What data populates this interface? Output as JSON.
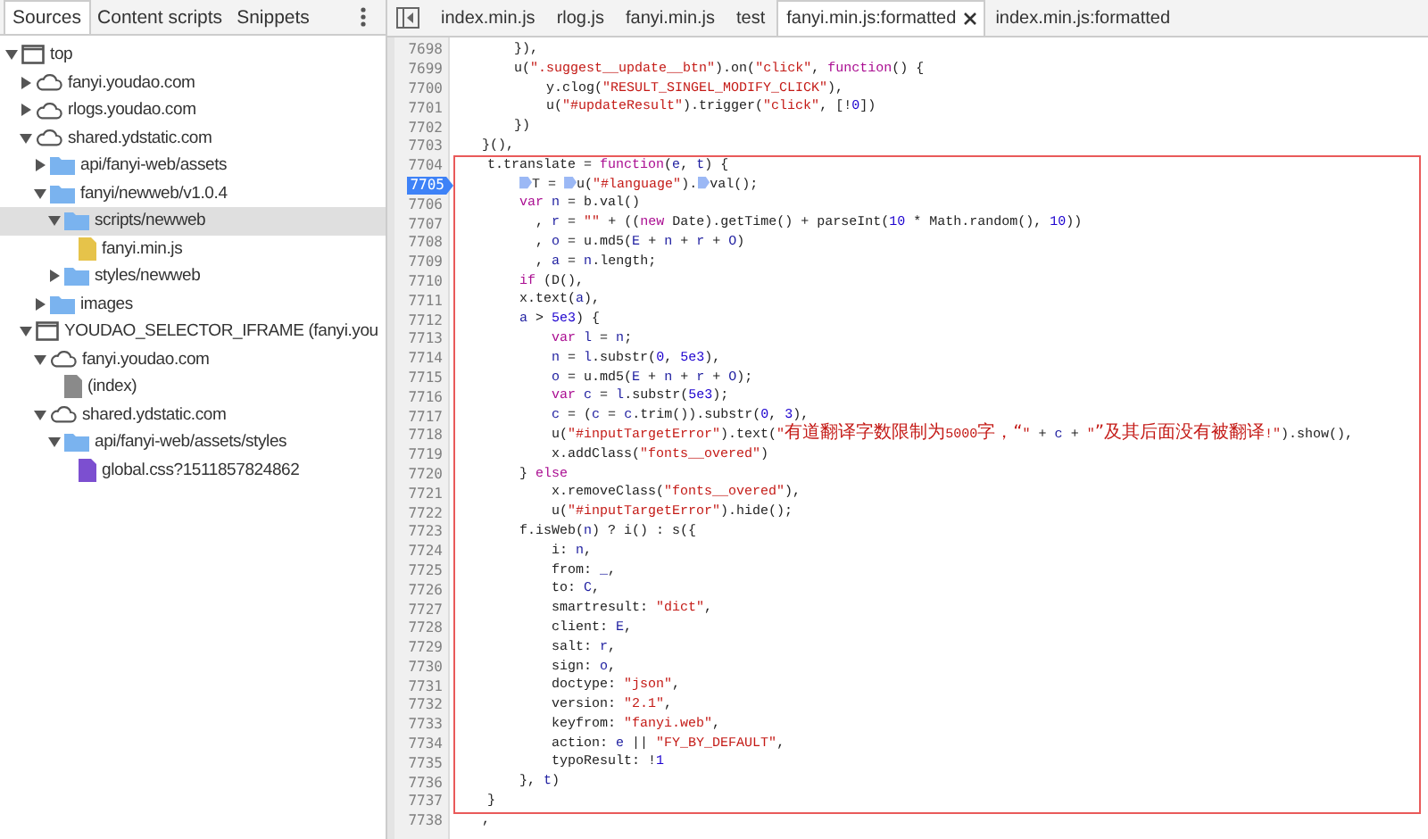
{
  "navigator": {
    "tabs": [
      {
        "label": "Sources",
        "selected": true
      },
      {
        "label": "Content scripts",
        "selected": false
      },
      {
        "label": "Snippets",
        "selected": false
      }
    ],
    "tree": [
      {
        "label": "top",
        "kind": "frame",
        "expanded": true,
        "selected": false,
        "children": [
          {
            "label": "fanyi.youdao.com",
            "kind": "domain",
            "expanded": false,
            "selected": false
          },
          {
            "label": "rlogs.youdao.com",
            "kind": "domain",
            "expanded": false,
            "selected": false
          },
          {
            "label": "shared.ydstatic.com",
            "kind": "domain",
            "expanded": true,
            "selected": false,
            "children": [
              {
                "label": "api/fanyi-web/assets",
                "kind": "folder",
                "expanded": false,
                "selected": false
              },
              {
                "label": "fanyi/newweb/v1.0.4",
                "kind": "folder",
                "expanded": true,
                "selected": false,
                "children": [
                  {
                    "label": "scripts/newweb",
                    "kind": "folder",
                    "expanded": true,
                    "selected": true,
                    "children": [
                      {
                        "label": "fanyi.min.js",
                        "kind": "script",
                        "selected": false
                      }
                    ]
                  },
                  {
                    "label": "styles/newweb",
                    "kind": "folder",
                    "expanded": false,
                    "selected": false
                  }
                ]
              },
              {
                "label": "images",
                "kind": "folder",
                "expanded": false,
                "selected": false
              }
            ]
          },
          {
            "label": "YOUDAO_SELECTOR_IFRAME (fanyi.you",
            "kind": "frame",
            "expanded": true,
            "selected": false,
            "children": [
              {
                "label": "fanyi.youdao.com",
                "kind": "domain",
                "expanded": true,
                "selected": false,
                "children": [
                  {
                    "label": "(index)",
                    "kind": "document",
                    "selected": false
                  }
                ]
              },
              {
                "label": "shared.ydstatic.com",
                "kind": "domain",
                "expanded": true,
                "selected": false,
                "children": [
                  {
                    "label": "api/fanyi-web/assets/styles",
                    "kind": "folder",
                    "expanded": true,
                    "selected": false,
                    "children": [
                      {
                        "label": "global.css?1511857824862",
                        "kind": "stylesheet",
                        "selected": false
                      }
                    ]
                  }
                ]
              }
            ]
          }
        ]
      }
    ]
  },
  "editor": {
    "tabs": [
      {
        "label": "index.min.js",
        "selected": false,
        "closable": false
      },
      {
        "label": "rlog.js",
        "selected": false,
        "closable": false
      },
      {
        "label": "fanyi.min.js",
        "selected": false,
        "closable": false
      },
      {
        "label": "test",
        "selected": false,
        "closable": false
      },
      {
        "label": "fanyi.min.js:formatted",
        "selected": true,
        "closable": true
      },
      {
        "label": "index.min.js:formatted",
        "selected": false,
        "closable": false
      }
    ],
    "blocks": [
      {
        "boxed": false,
        "lines": [
          {
            "number": "7698",
            "breakpoint": false,
            "segs": [
              {
                "kind": "plain",
                "text": "        }),"
              }
            ]
          },
          {
            "number": "7699",
            "breakpoint": false,
            "segs": [
              {
                "kind": "plain",
                "text": "        u("
              },
              {
                "kind": "string",
                "text": "\".suggest__update__btn\""
              },
              {
                "kind": "plain",
                "text": ").on("
              },
              {
                "kind": "string",
                "text": "\"click\""
              },
              {
                "kind": "plain",
                "text": ", "
              },
              {
                "kind": "keyword",
                "text": "function"
              },
              {
                "kind": "plain",
                "text": "() {"
              }
            ]
          },
          {
            "number": "7700",
            "breakpoint": false,
            "segs": [
              {
                "kind": "plain",
                "text": "            y.clog("
              },
              {
                "kind": "string",
                "text": "\"RESULT_SINGEL_MODIFY_CLICK\""
              },
              {
                "kind": "plain",
                "text": "),"
              }
            ]
          },
          {
            "number": "7701",
            "breakpoint": false,
            "segs": [
              {
                "kind": "plain",
                "text": "            u("
              },
              {
                "kind": "string",
                "text": "\"#updateResult\""
              },
              {
                "kind": "plain",
                "text": ").trigger("
              },
              {
                "kind": "string",
                "text": "\"click\""
              },
              {
                "kind": "plain",
                "text": ", [!"
              },
              {
                "kind": "number",
                "text": "0"
              },
              {
                "kind": "plain",
                "text": "])"
              }
            ]
          },
          {
            "number": "7702",
            "breakpoint": false,
            "segs": [
              {
                "kind": "plain",
                "text": "        })"
              }
            ]
          },
          {
            "number": "7703",
            "breakpoint": false,
            "segs": [
              {
                "kind": "plain",
                "text": "    }(),"
              }
            ]
          }
        ]
      },
      {
        "boxed": true,
        "lines": [
          {
            "number": "7704",
            "breakpoint": false,
            "segs": [
              {
                "kind": "plain",
                "text": "    t.translate = "
              },
              {
                "kind": "keyword",
                "text": "function"
              },
              {
                "kind": "plain",
                "text": "("
              },
              {
                "kind": "variable",
                "text": "e"
              },
              {
                "kind": "plain",
                "text": ", "
              },
              {
                "kind": "variable",
                "text": "t"
              },
              {
                "kind": "plain",
                "text": ") {"
              }
            ]
          },
          {
            "number": "7705",
            "breakpoint": true,
            "segs": [
              {
                "kind": "plain",
                "text": "        T = ",
                "marker": true
              },
              {
                "kind": "plain",
                "text": "u(",
                "marker": true
              },
              {
                "kind": "string",
                "text": "\"#language\""
              },
              {
                "kind": "plain",
                "text": ")."
              },
              {
                "kind": "plain",
                "text": "val();",
                "marker": true
              }
            ]
          },
          {
            "number": "7706",
            "breakpoint": false,
            "segs": [
              {
                "kind": "keyword",
                "text": "        var "
              },
              {
                "kind": "variable",
                "text": "n"
              },
              {
                "kind": "plain",
                "text": " = b.val()"
              }
            ]
          },
          {
            "number": "7707",
            "breakpoint": false,
            "segs": [
              {
                "kind": "plain",
                "text": "          , "
              },
              {
                "kind": "variable",
                "text": "r"
              },
              {
                "kind": "plain",
                "text": " = "
              },
              {
                "kind": "string",
                "text": "\"\""
              },
              {
                "kind": "plain",
                "text": " + (("
              },
              {
                "kind": "keyword",
                "text": "new"
              },
              {
                "kind": "plain",
                "text": " Date).getTime() + parseInt("
              },
              {
                "kind": "number",
                "text": "10"
              },
              {
                "kind": "plain",
                "text": " * Math.random(), "
              },
              {
                "kind": "number",
                "text": "10"
              },
              {
                "kind": "plain",
                "text": "))"
              }
            ]
          },
          {
            "number": "7708",
            "breakpoint": false,
            "segs": [
              {
                "kind": "plain",
                "text": "          , "
              },
              {
                "kind": "variable",
                "text": "o"
              },
              {
                "kind": "plain",
                "text": " = u.md5("
              },
              {
                "kind": "variable",
                "text": "E"
              },
              {
                "kind": "plain",
                "text": " + "
              },
              {
                "kind": "variable",
                "text": "n"
              },
              {
                "kind": "plain",
                "text": " + "
              },
              {
                "kind": "variable",
                "text": "r"
              },
              {
                "kind": "plain",
                "text": " + "
              },
              {
                "kind": "variable",
                "text": "O"
              },
              {
                "kind": "plain",
                "text": ")"
              }
            ]
          },
          {
            "number": "7709",
            "breakpoint": false,
            "segs": [
              {
                "kind": "plain",
                "text": "          , "
              },
              {
                "kind": "variable",
                "text": "a"
              },
              {
                "kind": "plain",
                "text": " = "
              },
              {
                "kind": "variable",
                "text": "n"
              },
              {
                "kind": "plain",
                "text": ".length;"
              }
            ]
          },
          {
            "number": "7710",
            "breakpoint": false,
            "segs": [
              {
                "kind": "keyword",
                "text": "        if"
              },
              {
                "kind": "plain",
                "text": " (D(),"
              }
            ]
          },
          {
            "number": "7711",
            "breakpoint": false,
            "segs": [
              {
                "kind": "plain",
                "text": "        x.text("
              },
              {
                "kind": "variable",
                "text": "a"
              },
              {
                "kind": "plain",
                "text": "),"
              }
            ]
          },
          {
            "number": "7712",
            "breakpoint": false,
            "segs": [
              {
                "kind": "variable",
                "text": "        a"
              },
              {
                "kind": "plain",
                "text": " > "
              },
              {
                "kind": "number",
                "text": "5e3"
              },
              {
                "kind": "plain",
                "text": ") {"
              }
            ]
          },
          {
            "number": "7713",
            "breakpoint": false,
            "segs": [
              {
                "kind": "keyword",
                "text": "            var "
              },
              {
                "kind": "variable",
                "text": "l"
              },
              {
                "kind": "plain",
                "text": " = "
              },
              {
                "kind": "variable",
                "text": "n"
              },
              {
                "kind": "plain",
                "text": ";"
              }
            ]
          },
          {
            "number": "7714",
            "breakpoint": false,
            "segs": [
              {
                "kind": "variable",
                "text": "            n"
              },
              {
                "kind": "plain",
                "text": " = "
              },
              {
                "kind": "variable",
                "text": "l"
              },
              {
                "kind": "plain",
                "text": ".substr("
              },
              {
                "kind": "number",
                "text": "0"
              },
              {
                "kind": "plain",
                "text": ", "
              },
              {
                "kind": "number",
                "text": "5e3"
              },
              {
                "kind": "plain",
                "text": "),"
              }
            ]
          },
          {
            "number": "7715",
            "breakpoint": false,
            "segs": [
              {
                "kind": "variable",
                "text": "            o"
              },
              {
                "kind": "plain",
                "text": " = u.md5("
              },
              {
                "kind": "variable",
                "text": "E"
              },
              {
                "kind": "plain",
                "text": " + "
              },
              {
                "kind": "variable",
                "text": "n"
              },
              {
                "kind": "plain",
                "text": " + "
              },
              {
                "kind": "variable",
                "text": "r"
              },
              {
                "kind": "plain",
                "text": " + "
              },
              {
                "kind": "variable",
                "text": "O"
              },
              {
                "kind": "plain",
                "text": ");"
              }
            ]
          },
          {
            "number": "7716",
            "breakpoint": false,
            "segs": [
              {
                "kind": "keyword",
                "text": "            var "
              },
              {
                "kind": "variable",
                "text": "c"
              },
              {
                "kind": "plain",
                "text": " = "
              },
              {
                "kind": "variable",
                "text": "l"
              },
              {
                "kind": "plain",
                "text": ".substr("
              },
              {
                "kind": "number",
                "text": "5e3"
              },
              {
                "kind": "plain",
                "text": ");"
              }
            ]
          },
          {
            "number": "7717",
            "breakpoint": false,
            "segs": [
              {
                "kind": "variable",
                "text": "            c"
              },
              {
                "kind": "plain",
                "text": " = ("
              },
              {
                "kind": "variable",
                "text": "c"
              },
              {
                "kind": "plain",
                "text": " = "
              },
              {
                "kind": "variable",
                "text": "c"
              },
              {
                "kind": "plain",
                "text": ".trim()).substr("
              },
              {
                "kind": "number",
                "text": "0"
              },
              {
                "kind": "plain",
                "text": ", "
              },
              {
                "kind": "number",
                "text": "3"
              },
              {
                "kind": "plain",
                "text": "),"
              }
            ]
          },
          {
            "number": "7718",
            "breakpoint": false,
            "segs": [
              {
                "kind": "plain",
                "text": "            u("
              },
              {
                "kind": "string",
                "text": "\"#inputTargetError\""
              },
              {
                "kind": "plain",
                "text": ").text("
              },
              {
                "kind": "string",
                "text": "\"有道翻译字数限制为5000字，“\""
              },
              {
                "kind": "plain",
                "text": " + "
              },
              {
                "kind": "variable",
                "text": "c"
              },
              {
                "kind": "plain",
                "text": " + "
              },
              {
                "kind": "string",
                "text": "\"”及其后面没有被翻译!\""
              },
              {
                "kind": "plain",
                "text": ").show(),"
              }
            ]
          },
          {
            "number": "7719",
            "breakpoint": false,
            "segs": [
              {
                "kind": "plain",
                "text": "            x.addClass("
              },
              {
                "kind": "string",
                "text": "\"fonts__overed\""
              },
              {
                "kind": "plain",
                "text": ")"
              }
            ]
          },
          {
            "number": "7720",
            "breakpoint": false,
            "segs": [
              {
                "kind": "plain",
                "text": "        } "
              },
              {
                "kind": "keyword",
                "text": "else"
              }
            ]
          },
          {
            "number": "7721",
            "breakpoint": false,
            "segs": [
              {
                "kind": "plain",
                "text": "            x.removeClass("
              },
              {
                "kind": "string",
                "text": "\"fonts__overed\""
              },
              {
                "kind": "plain",
                "text": "),"
              }
            ]
          },
          {
            "number": "7722",
            "breakpoint": false,
            "segs": [
              {
                "kind": "plain",
                "text": "            u("
              },
              {
                "kind": "string",
                "text": "\"#inputTargetError\""
              },
              {
                "kind": "plain",
                "text": ").hide();"
              }
            ]
          },
          {
            "number": "7723",
            "breakpoint": false,
            "segs": [
              {
                "kind": "plain",
                "text": "        f.isWeb("
              },
              {
                "kind": "variable",
                "text": "n"
              },
              {
                "kind": "plain",
                "text": ") ? i() : s({"
              }
            ]
          },
          {
            "number": "7724",
            "breakpoint": false,
            "segs": [
              {
                "kind": "plain",
                "text": "            i: "
              },
              {
                "kind": "variable",
                "text": "n"
              },
              {
                "kind": "plain",
                "text": ","
              }
            ]
          },
          {
            "number": "7725",
            "breakpoint": false,
            "segs": [
              {
                "kind": "plain",
                "text": "            from: "
              },
              {
                "kind": "variable",
                "text": "_"
              },
              {
                "kind": "plain",
                "text": ","
              }
            ]
          },
          {
            "number": "7726",
            "breakpoint": false,
            "segs": [
              {
                "kind": "plain",
                "text": "            to: "
              },
              {
                "kind": "variable",
                "text": "C"
              },
              {
                "kind": "plain",
                "text": ","
              }
            ]
          },
          {
            "number": "7727",
            "breakpoint": false,
            "segs": [
              {
                "kind": "plain",
                "text": "            smartresult: "
              },
              {
                "kind": "string",
                "text": "\"dict\""
              },
              {
                "kind": "plain",
                "text": ","
              }
            ]
          },
          {
            "number": "7728",
            "breakpoint": false,
            "segs": [
              {
                "kind": "plain",
                "text": "            client: "
              },
              {
                "kind": "variable",
                "text": "E"
              },
              {
                "kind": "plain",
                "text": ","
              }
            ]
          },
          {
            "number": "7729",
            "breakpoint": false,
            "segs": [
              {
                "kind": "plain",
                "text": "            salt: "
              },
              {
                "kind": "variable",
                "text": "r"
              },
              {
                "kind": "plain",
                "text": ","
              }
            ]
          },
          {
            "number": "7730",
            "breakpoint": false,
            "segs": [
              {
                "kind": "plain",
                "text": "            sign: "
              },
              {
                "kind": "variable",
                "text": "o"
              },
              {
                "kind": "plain",
                "text": ","
              }
            ]
          },
          {
            "number": "7731",
            "breakpoint": false,
            "segs": [
              {
                "kind": "plain",
                "text": "            doctype: "
              },
              {
                "kind": "string",
                "text": "\"json\""
              },
              {
                "kind": "plain",
                "text": ","
              }
            ]
          },
          {
            "number": "7732",
            "breakpoint": false,
            "segs": [
              {
                "kind": "plain",
                "text": "            version: "
              },
              {
                "kind": "string",
                "text": "\"2.1\""
              },
              {
                "kind": "plain",
                "text": ","
              }
            ]
          },
          {
            "number": "7733",
            "breakpoint": false,
            "segs": [
              {
                "kind": "plain",
                "text": "            keyfrom: "
              },
              {
                "kind": "string",
                "text": "\"fanyi.web\""
              },
              {
                "kind": "plain",
                "text": ","
              }
            ]
          },
          {
            "number": "7734",
            "breakpoint": false,
            "segs": [
              {
                "kind": "plain",
                "text": "            action: "
              },
              {
                "kind": "variable",
                "text": "e"
              },
              {
                "kind": "plain",
                "text": " || "
              },
              {
                "kind": "string",
                "text": "\"FY_BY_DEFAULT\""
              },
              {
                "kind": "plain",
                "text": ","
              }
            ]
          },
          {
            "number": "7735",
            "breakpoint": false,
            "segs": [
              {
                "kind": "plain",
                "text": "            typoResult: !"
              },
              {
                "kind": "number",
                "text": "1"
              }
            ]
          },
          {
            "number": "7736",
            "breakpoint": false,
            "segs": [
              {
                "kind": "plain",
                "text": "        }, "
              },
              {
                "kind": "variable",
                "text": "t"
              },
              {
                "kind": "plain",
                "text": ")"
              }
            ]
          },
          {
            "number": "7737",
            "breakpoint": false,
            "segs": [
              {
                "kind": "plain",
                "text": "    }"
              }
            ]
          }
        ]
      },
      {
        "boxed": false,
        "lines": [
          {
            "number": "7738",
            "breakpoint": false,
            "segs": [
              {
                "kind": "plain",
                "text": "    ,"
              }
            ]
          }
        ]
      }
    ]
  }
}
